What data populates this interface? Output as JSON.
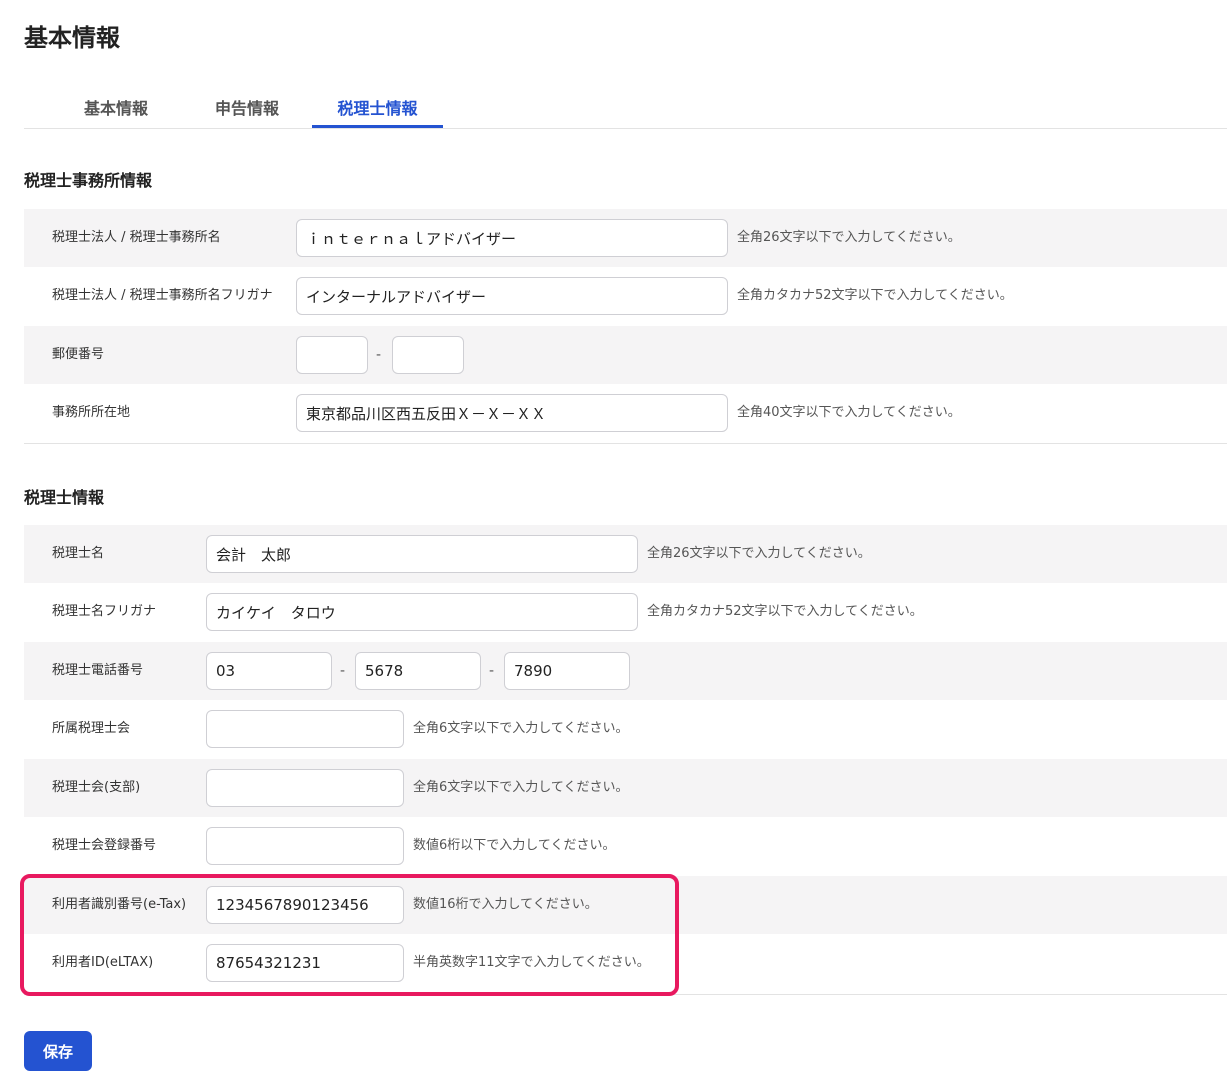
{
  "page_title": "基本情報",
  "tabs": [
    {
      "label": "基本情報",
      "active": false
    },
    {
      "label": "申告情報",
      "active": false
    },
    {
      "label": "税理士情報",
      "active": true
    }
  ],
  "office_section": {
    "title": "税理士事務所情報",
    "office_name": {
      "label": "税理士法人 / 税理士事務所名",
      "value": "ｉｎｔｅｒｎａｌアドバイザー",
      "hint": "全角26文字以下で入力してください。"
    },
    "office_kana": {
      "label": "税理士法人 / 税理士事務所名フリガナ",
      "value": "インターナルアドバイザー",
      "hint": "全角カタカナ52文字以下で入力してください。"
    },
    "postal": {
      "label": "郵便番号",
      "part1": "",
      "part2": "",
      "separator": "-"
    },
    "address": {
      "label": "事務所所在地",
      "value": "東京都品川区西五反田Ｘ－Ｘ－ＸＸ",
      "hint": "全角40文字以下で入力してください。"
    }
  },
  "accountant_section": {
    "title": "税理士情報",
    "name": {
      "label": "税理士名",
      "value": "会計　太郎",
      "hint": "全角26文字以下で入力してください。"
    },
    "kana": {
      "label": "税理士名フリガナ",
      "value": "カイケイ　タロウ",
      "hint": "全角カタカナ52文字以下で入力してください。"
    },
    "phone": {
      "label": "税理士電話番号",
      "part1": "03",
      "part2": "5678",
      "part3": "7890",
      "separator": "-"
    },
    "association": {
      "label": "所属税理士会",
      "value": "",
      "hint": "全角6文字以下で入力してください。"
    },
    "branch": {
      "label": "税理士会(支部)",
      "value": "",
      "hint": "全角6文字以下で入力してください。"
    },
    "registration": {
      "label": "税理士会登録番号",
      "value": "",
      "hint": "数値6桁以下で入力してください。"
    },
    "etax": {
      "label": "利用者識別番号(e-Tax)",
      "value": "1234567890123456",
      "hint": "数値16桁で入力してください。"
    },
    "eltax": {
      "label": "利用者ID(eLTAX)",
      "value": "87654321231",
      "hint": "半角英数字11文字で入力してください。"
    }
  },
  "save_label": "保存",
  "colors": {
    "accent": "#2453d1",
    "highlight": "#e8195f",
    "row_shade": "#f5f4f5"
  }
}
